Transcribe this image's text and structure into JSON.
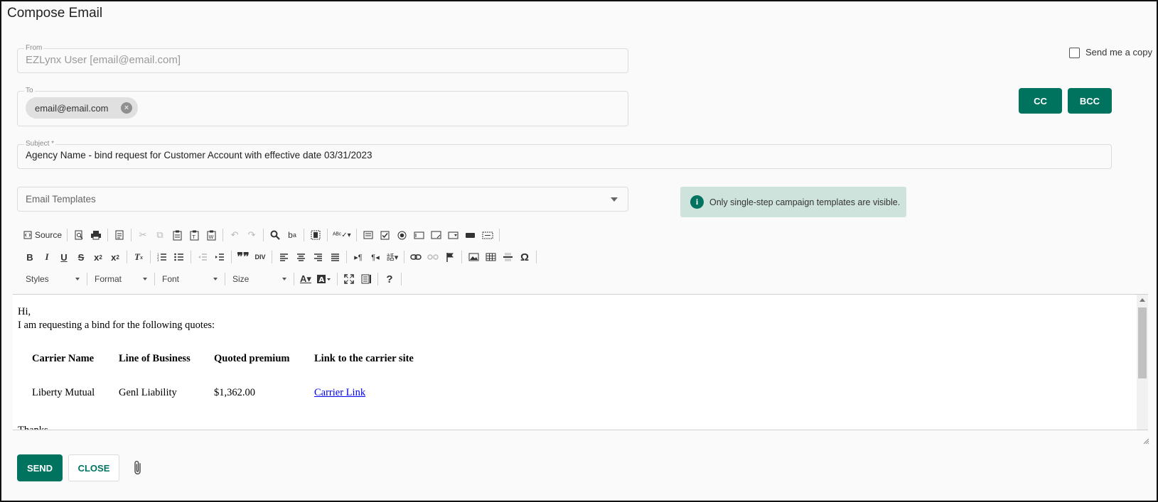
{
  "window": {
    "title": "Compose Email"
  },
  "from": {
    "label": "From",
    "value": "EZLynx User [email@email.com]"
  },
  "to": {
    "label": "To",
    "recipients": [
      "email@email.com"
    ]
  },
  "send_copy": {
    "label": "Send me a copy",
    "checked": false
  },
  "buttons": {
    "cc": "CC",
    "bcc": "BCC",
    "send": "SEND",
    "close": "CLOSE"
  },
  "subject": {
    "label": "Subject *",
    "value": "Agency Name - bind request for Customer Account with effective date 03/31/2023"
  },
  "templates": {
    "placeholder": "Email Templates"
  },
  "info": {
    "text": "Only single-step campaign templates are visible."
  },
  "toolbar": {
    "source_label": "Source",
    "combos": {
      "styles": "Styles",
      "format": "Format",
      "font": "Font",
      "size": "Size"
    }
  },
  "editor": {
    "greeting": "Hi,",
    "intro": "I am requesting a bind for the following quotes:",
    "table": {
      "headers": [
        "Carrier Name",
        "Line of Business",
        "Quoted premium",
        "Link to the carrier site"
      ],
      "rows": [
        [
          "Liberty Mutual",
          "Genl Liability",
          "$1,362.00",
          "Carrier Link"
        ]
      ]
    },
    "closing": "Thanks,"
  },
  "colors": {
    "accent": "#00735f",
    "info_bg": "#cfe3dd",
    "link": "#0000ee"
  }
}
